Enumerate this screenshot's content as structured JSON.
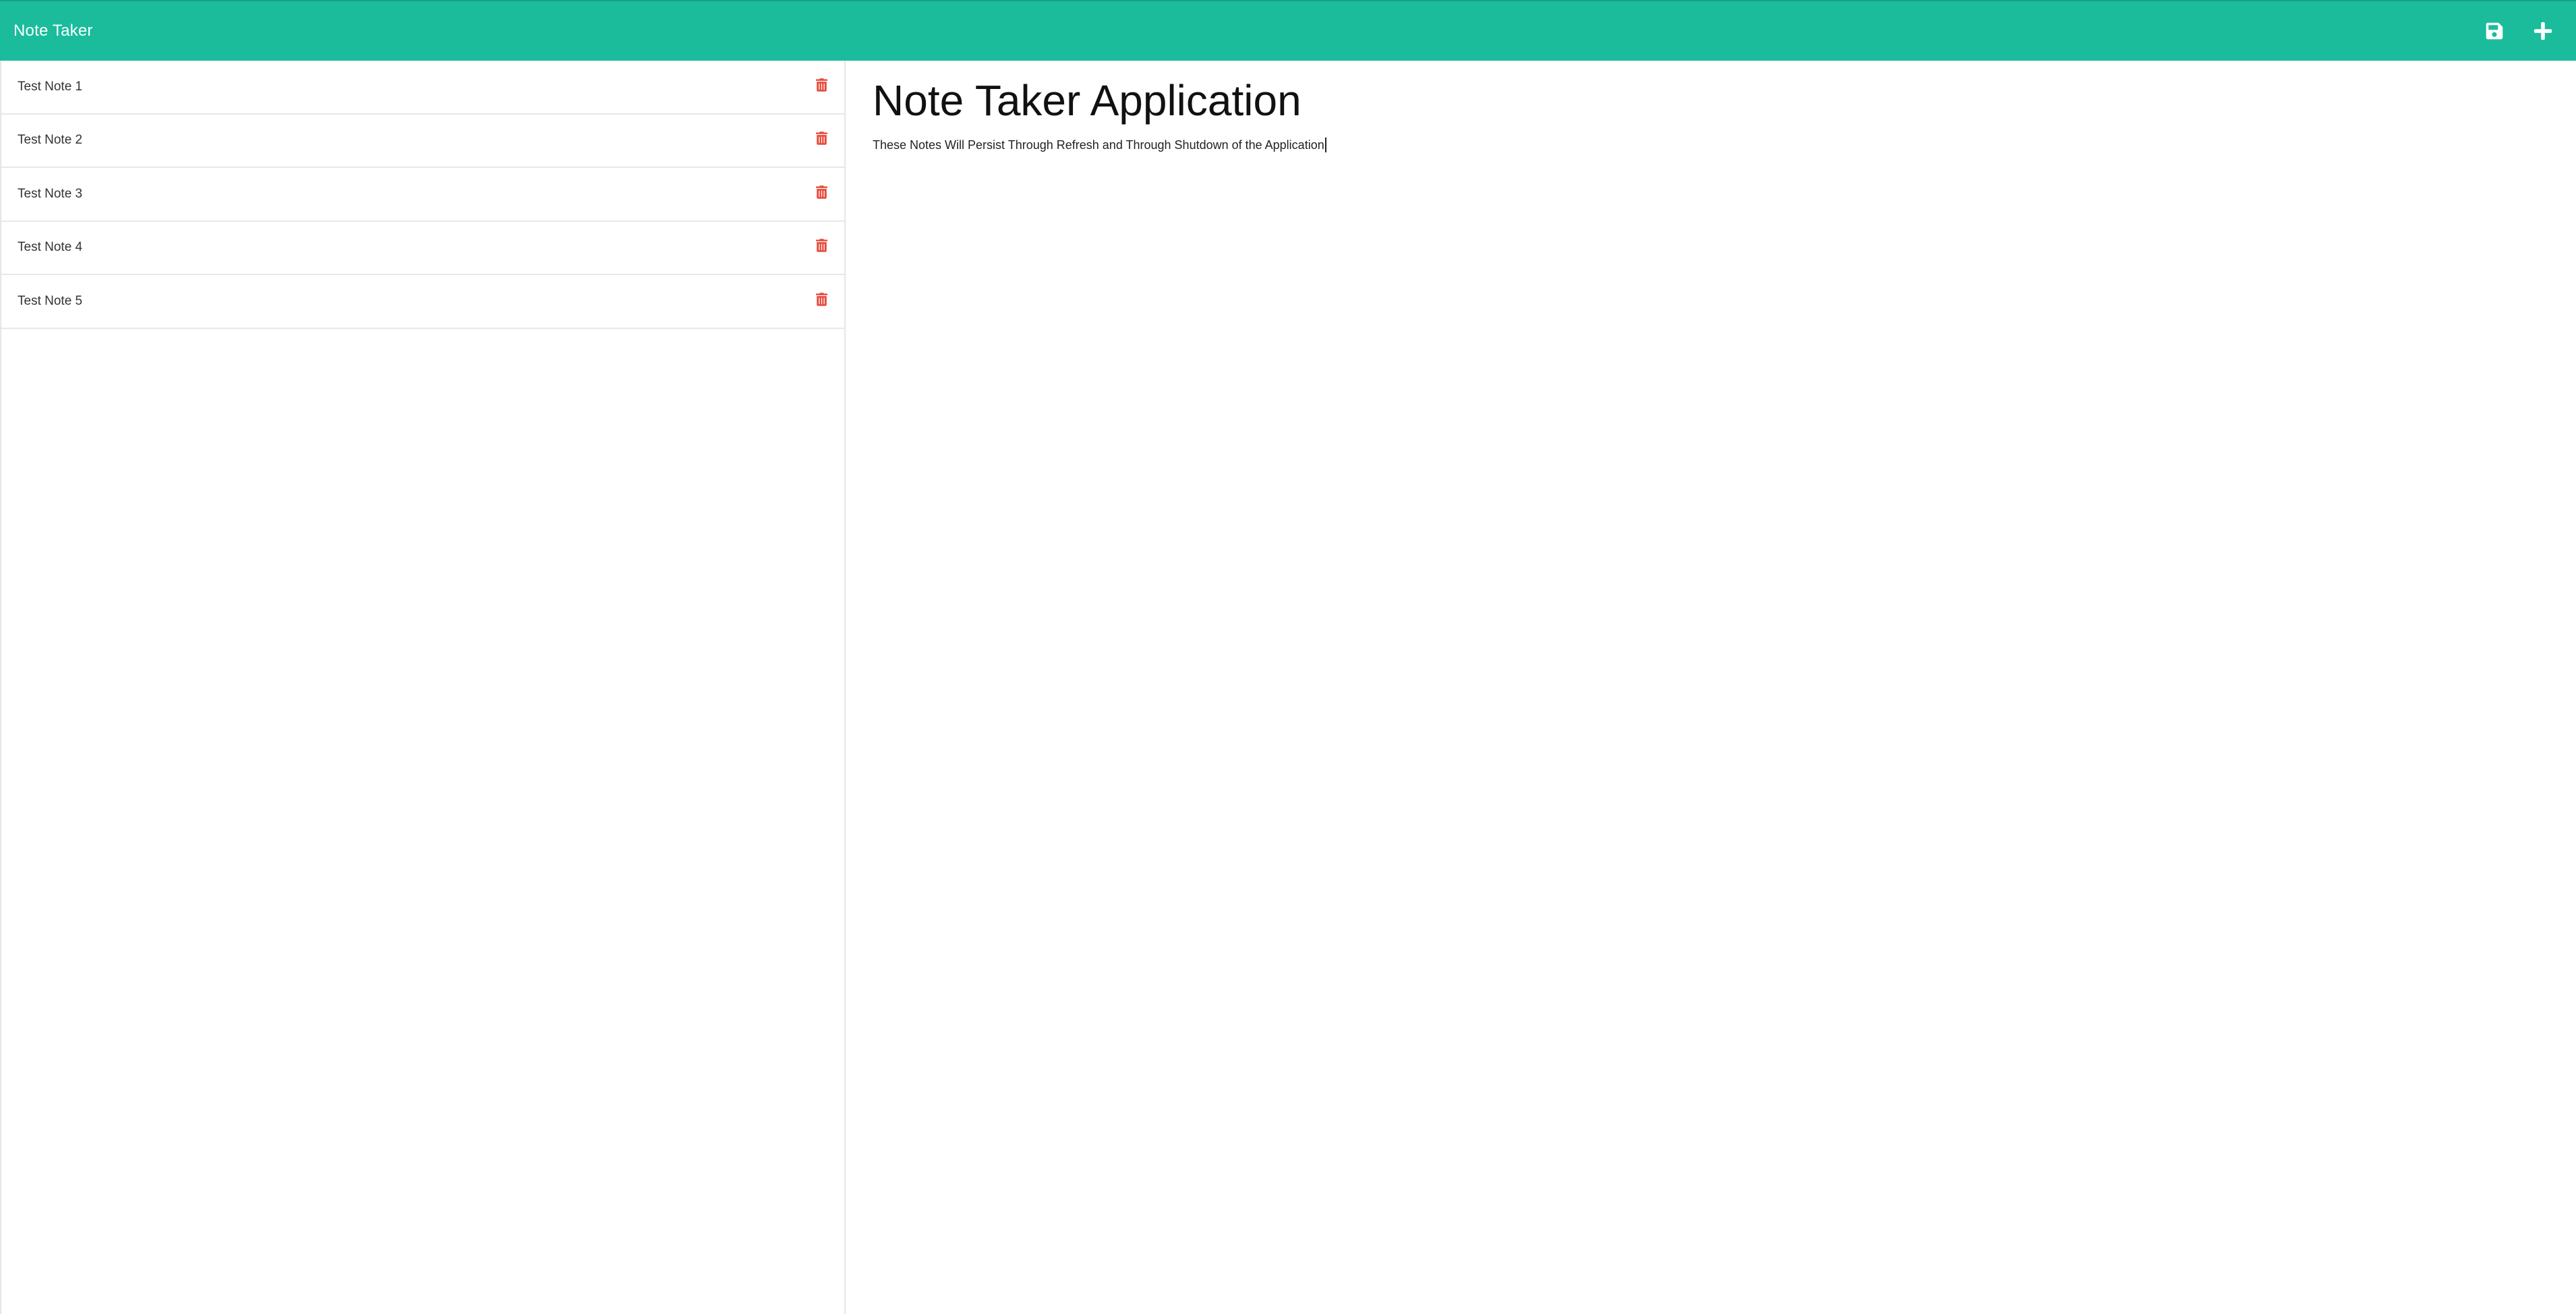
{
  "navbar": {
    "brand": "Note Taker",
    "background_color": "#1abc9c",
    "icons": [
      "save-icon",
      "plus-icon"
    ]
  },
  "sidebar": {
    "notes": [
      {
        "title": "Test Note 1",
        "icon": "trash-icon"
      },
      {
        "title": "Test Note 2",
        "icon": "trash-icon"
      },
      {
        "title": "Test Note 3",
        "icon": "trash-icon"
      },
      {
        "title": "Test Note 4",
        "icon": "trash-icon"
      },
      {
        "title": "Test Note 5",
        "icon": "trash-icon"
      }
    ],
    "delete_icon_color": "#e74c3c"
  },
  "editor": {
    "title": "Note Taker Application",
    "body": "These Notes Will Persist Through Refresh and Through Shutdown of the Application"
  }
}
